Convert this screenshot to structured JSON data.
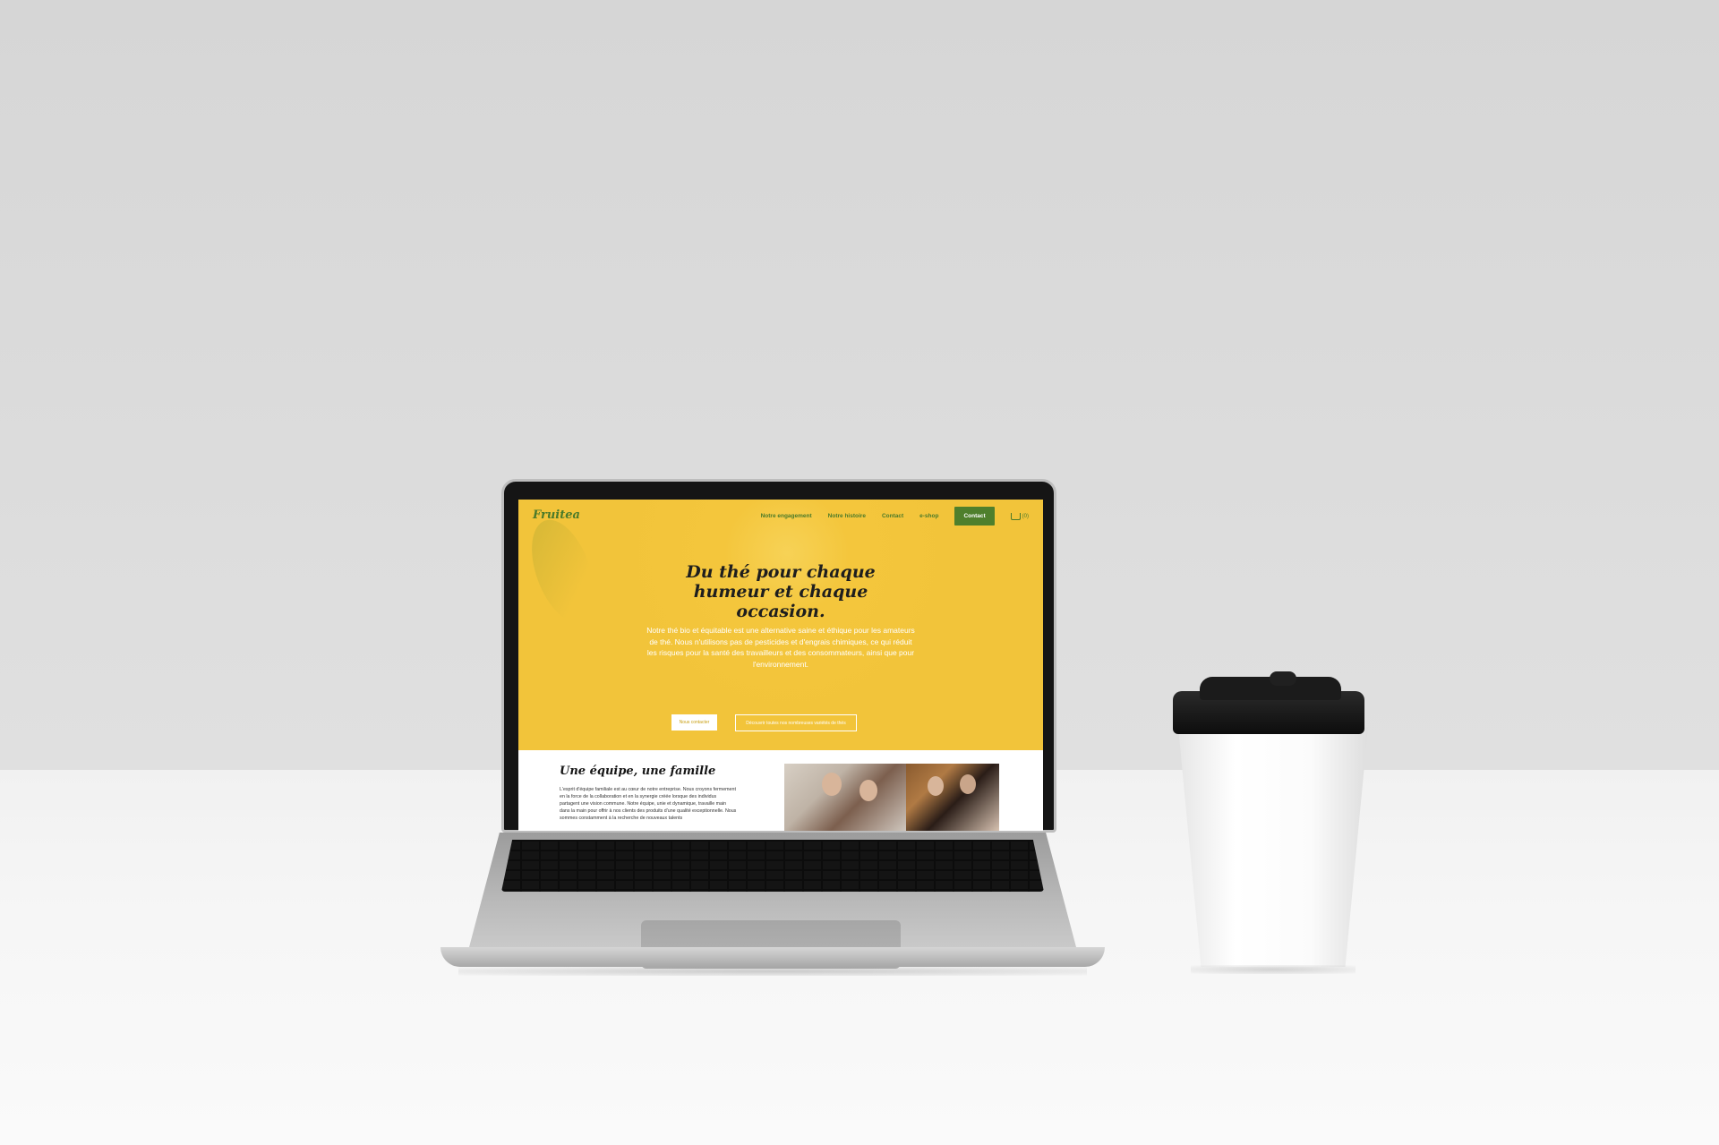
{
  "site": {
    "logo": "Fruitea",
    "nav": {
      "items": [
        "Notre engagement",
        "Notre histoire",
        "Contact",
        "e-shop"
      ],
      "cta": "Contact",
      "cart": "(0)"
    },
    "hero": {
      "title": "Du thé pour chaque humeur et chaque occasion.",
      "text": "Notre thé bio et équitable est une alternative saine et éthique pour les amateurs de thé. Nous n'utilisons pas de pesticides et d'engrais chimiques, ce qui réduit les risques pour la santé des travailleurs et des consommateurs, ainsi que pour l'environnement.",
      "primary_button": "Nous contacter",
      "secondary_button": "Découvrir toutes nos nombreuses variétés de thés"
    },
    "team": {
      "title": "Une équipe, une famille",
      "text": "L'esprit d'équipe familiale est au cœur de notre entreprise. Nous croyons fermement en la force de la collaboration et en la synergie créée lorsque des individus partagent une vision commune. Notre équipe, unie et dynamique, travaille main dans la main pour offrir à nos clients des produits d'une qualité exceptionnelle. Nous sommes constamment à la recherche de nouveaux talents"
    }
  },
  "colors": {
    "hero_bg": "#f4c63c",
    "brand_green": "#4f7f2c"
  }
}
